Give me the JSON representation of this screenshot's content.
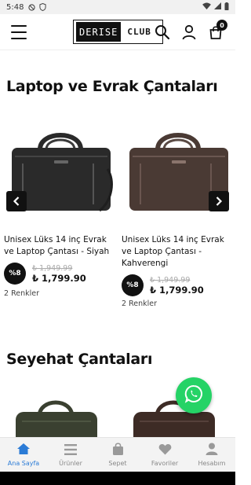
{
  "status_bar": {
    "time": "5:48"
  },
  "header": {
    "logo_part1": "DERISE",
    "logo_part2": "CLUB",
    "cart_count": "0"
  },
  "sections": [
    {
      "title": "Laptop ve Evrak Çantaları",
      "products": [
        {
          "name": "Unisex Lüks 14 inç Evrak ve Laptop Çantası - Siyah",
          "discount": "%8",
          "old_price": "₺ 1,949.99",
          "new_price": "₺ 1,799.90",
          "colors": "2 Renkler",
          "bag_color": "#2a2a2a"
        },
        {
          "name": "Unisex Lüks 14 inç Evrak ve Laptop Çantası - Kahverengi",
          "discount": "%8",
          "old_price": "₺ 1,949.99",
          "new_price": "₺ 1,799.90",
          "colors": "2 Renkler",
          "bag_color": "#4a3a34"
        }
      ]
    },
    {
      "title": "Seyehat Çantaları",
      "products": [
        {
          "bag_color": "#3a4030"
        },
        {
          "bag_color": "#3d2b25"
        }
      ]
    }
  ],
  "bottom_nav": [
    {
      "label": "Ana Sayfa",
      "icon": "home-icon",
      "active": true
    },
    {
      "label": "Ürünler",
      "icon": "list-icon",
      "active": false
    },
    {
      "label": "Sepet",
      "icon": "bag-icon",
      "active": false
    },
    {
      "label": "Favoriler",
      "icon": "heart-icon",
      "active": false
    },
    {
      "label": "Hesabım",
      "icon": "user-icon",
      "active": false
    }
  ],
  "colors": {
    "accent": "#2b7bd6",
    "whatsapp": "#25d366"
  }
}
